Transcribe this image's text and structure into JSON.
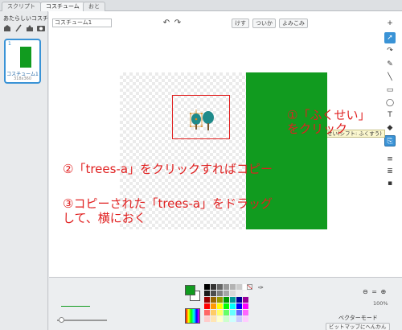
{
  "tabs": [
    "スクリプト",
    "コスチューム",
    "おと"
  ],
  "left": {
    "new_costume_label": "あたらしいコスチューム:",
    "new_icons": [
      "paint-brush-icon",
      "camera-icon"
    ],
    "costume": {
      "number": "1",
      "name": "コスチューム1",
      "size": "318x360"
    }
  },
  "editor": {
    "costume_name": "コスチューム1",
    "buttons": {
      "clear": "けす",
      "add": "ついか",
      "import": "よみこみ"
    },
    "tooltip": "ふくせい(シフト: ふくすう)",
    "zoom_percent": "100%",
    "mode_label": "ベクターモード",
    "mode_button": "ビットマップにへんかん"
  },
  "annotations": {
    "step1_line1": "①「ふくせい」",
    "step1_line2": "をクリック",
    "step2": "②「trees-a」をクリックすればコピー",
    "step3_line1": "③コピーされた「trees-a」をドラッグ",
    "step3_line2": "して、横におく"
  },
  "colors": {
    "accent": "#3a93d6",
    "annotation_red": "#e02020",
    "fill_green": "#119b1f"
  },
  "palette": [
    "#000000",
    "#333333",
    "#666666",
    "#999999",
    "#b3b3b3",
    "#cccccc",
    "#ffffff",
    "#1a1a1a",
    "#4d4d4d",
    "#808080",
    "#a6a6a6",
    "#d9d9d9",
    "#eeeeee",
    "#f5f5f5",
    "#990000",
    "#996600",
    "#999900",
    "#009900",
    "#009999",
    "#000099",
    "#990099",
    "#ff0000",
    "#ff9900",
    "#ffff00",
    "#00ff00",
    "#00ffff",
    "#0000ff",
    "#ff00ff",
    "#ff6666",
    "#ffcc66",
    "#ffff66",
    "#66ff66",
    "#66ffff",
    "#6666ff",
    "#ff66ff",
    "#ffcccc",
    "#ffe5b3",
    "#ffffcc",
    "#ccffcc",
    "#ccffff",
    "#ccccff",
    "#ffccff"
  ]
}
